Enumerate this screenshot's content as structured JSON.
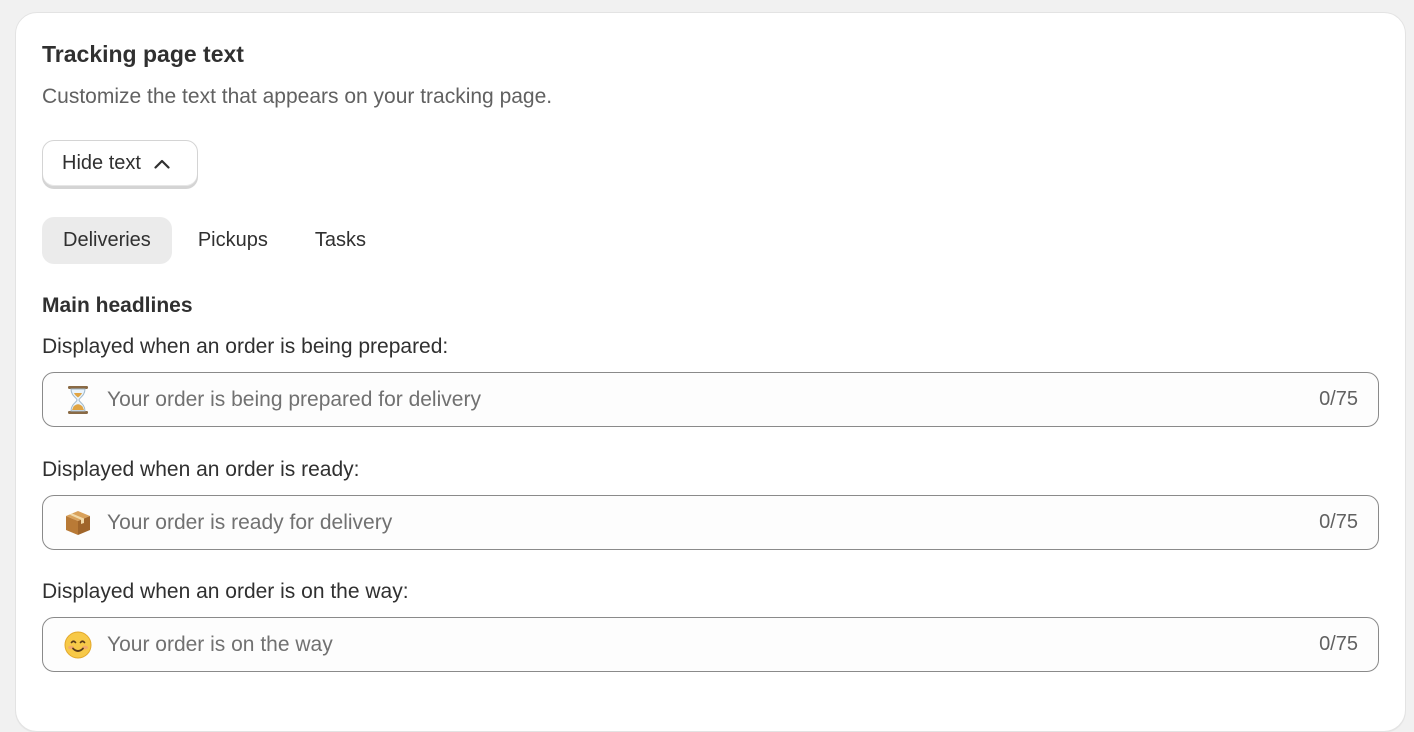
{
  "card": {
    "title": "Tracking page text",
    "subtitle": "Customize the text that appears on your tracking page."
  },
  "toggle": {
    "label": "Hide text",
    "icon": "chevron-up-icon"
  },
  "tabs": [
    {
      "label": "Deliveries",
      "active": true
    },
    {
      "label": "Pickups",
      "active": false
    },
    {
      "label": "Tasks",
      "active": false
    }
  ],
  "section": {
    "heading": "Main headlines"
  },
  "fields": [
    {
      "label": "Displayed when an order is being prepared:",
      "icon": "hourglass-icon",
      "value": "",
      "placeholder": "Your order is being prepared for delivery",
      "counter": "0/75"
    },
    {
      "label": "Displayed when an order is ready:",
      "icon": "package-icon",
      "value": "",
      "placeholder": "Your order is ready for delivery",
      "counter": "0/75"
    },
    {
      "label": "Displayed when an order is on the way:",
      "icon": "smiling-face-icon",
      "value": "",
      "placeholder": "Your order is on the way",
      "counter": "0/75"
    }
  ],
  "colors": {
    "card_bg": "#ffffff",
    "page_bg": "#f1f1f1",
    "active_tab_bg": "#ebebeb",
    "field_border": "#8a8a8a",
    "text": "#303030",
    "muted_text": "#616161"
  }
}
